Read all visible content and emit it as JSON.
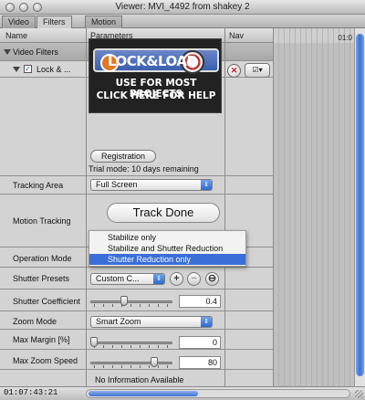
{
  "window": {
    "title": "Viewer: MVI_4492 from shakey 2"
  },
  "tabs": [
    "Video",
    "Filters",
    "Motion"
  ],
  "columns": {
    "name": "Name",
    "parameters": "Parameters",
    "nav": "Nav"
  },
  "timeline": {
    "ruler_label": "01:0"
  },
  "sections": {
    "video_filters": "Video Filters",
    "filter_name": "Lock & ..."
  },
  "banner": {
    "logo": "LOCK&LOAD",
    "line1": "USE FOR MOST PROJECTS",
    "line2": "CLICK HERE FOR HELP"
  },
  "registration_button": "Registration",
  "trial_text": "Trial mode: 10 days remaining",
  "params": {
    "tracking_area": {
      "label": "Tracking Area",
      "value": "Full Screen"
    },
    "motion_tracking": {
      "label": "Motion Tracking",
      "button": "Track Done"
    },
    "operation_mode": {
      "label": "Operation Mode"
    },
    "shutter_presets": {
      "label": "Shutter Presets",
      "value": "Custom C..."
    },
    "shutter_coefficient": {
      "label": "Shutter Coefficient",
      "value": "0.4",
      "level": 0.4
    },
    "zoom_mode": {
      "label": "Zoom Mode",
      "value": "Smart Zoom"
    },
    "max_margin": {
      "label": "Max Margin [%]",
      "value": "0",
      "level": 0.0
    },
    "max_zoom_speed": {
      "label": "Max Zoom Speed",
      "value": "80",
      "level": 0.8
    },
    "info": {
      "value": "No Information Available"
    }
  },
  "operation_menu": {
    "options": [
      "Stabilize only",
      "Stabilize and Shutter Reduction",
      "Shutter Reduction only"
    ],
    "selected_index": 2
  },
  "status": {
    "timecode": "01:07:43:21"
  },
  "colors": {
    "accent": "#3a6fd8",
    "close": "#c0151a"
  }
}
